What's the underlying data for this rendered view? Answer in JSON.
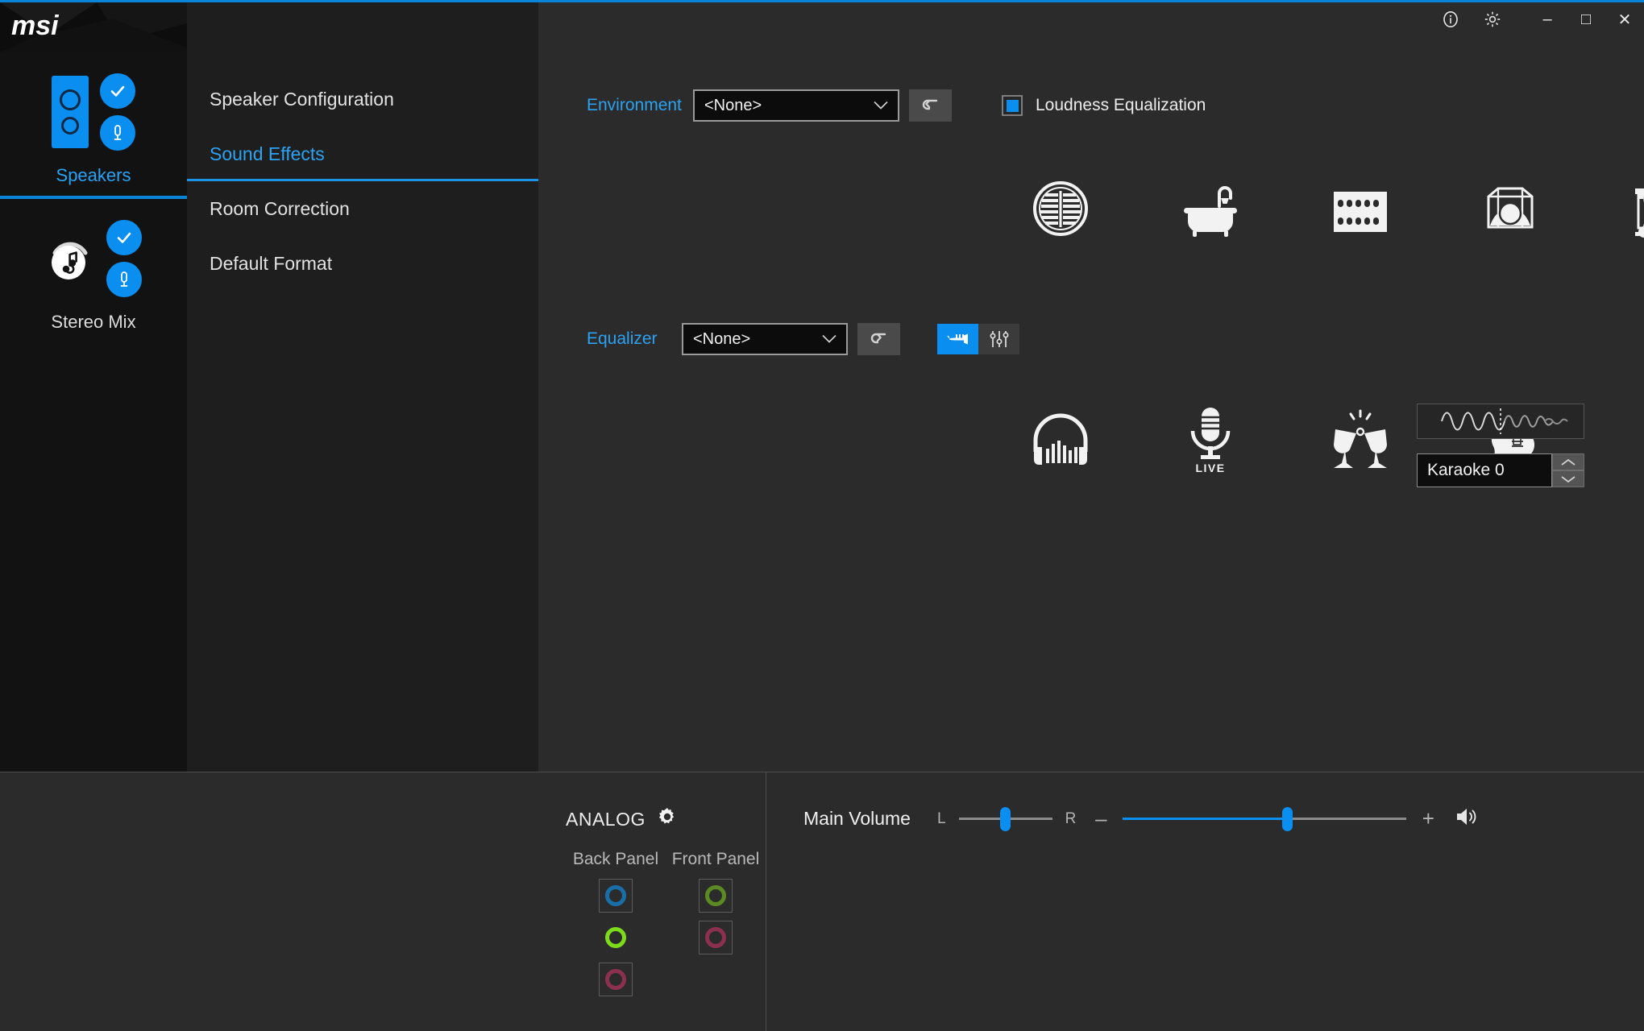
{
  "window": {
    "accent_color": "#0a8ef0",
    "titlebar": {
      "info_icon": "info-icon",
      "settings_icon": "gear-icon",
      "minimize": "–",
      "maximize": "□",
      "close": "✕"
    }
  },
  "brand": {
    "logo_text": "msi"
  },
  "sidebar": {
    "devices": [
      {
        "label": "Speakers",
        "icon": "speaker-icon",
        "active": true,
        "badges": [
          "check-icon",
          "microphone-icon"
        ]
      },
      {
        "label": "Stereo Mix",
        "icon": "music-note-icon",
        "active": false,
        "badges": [
          "check-icon",
          "microphone-icon"
        ]
      }
    ]
  },
  "nav": {
    "items": [
      {
        "label": "Speaker Configuration",
        "selected": false
      },
      {
        "label": "Sound Effects",
        "selected": true
      },
      {
        "label": "Room Correction",
        "selected": false
      },
      {
        "label": "Default Format",
        "selected": false
      }
    ]
  },
  "main": {
    "environment": {
      "label": "Environment",
      "value": "<None>",
      "placeholder": "<None>",
      "reset_icon": "reset-arrow-icon",
      "loudness": {
        "label": "Loudness Equalization",
        "checked": true
      }
    },
    "environment_presets": [
      {
        "name": "padded-cell-icon"
      },
      {
        "name": "bathroom-icon"
      },
      {
        "name": "stone-corridor-icon"
      },
      {
        "name": "arena-icon"
      },
      {
        "name": "auditorium-icon"
      }
    ],
    "equalizer": {
      "label": "Equalizer",
      "value": "<None>",
      "placeholder": "<None>",
      "reset_icon": "reset-arrow-icon",
      "mode_buttons": [
        {
          "name": "trumpet-icon",
          "active": true
        },
        {
          "name": "sliders-icon",
          "active": false
        }
      ]
    },
    "equalizer_presets": [
      {
        "name": "headphones-icon"
      },
      {
        "name": "live-microphone-icon",
        "caption": "LIVE"
      },
      {
        "name": "party-glasses-icon"
      },
      {
        "name": "electric-guitar-icon"
      }
    ],
    "karaoke": {
      "waveform_icon": "waveform-icon",
      "value": "Karaoke 0",
      "up_icon": "chevron-up-icon",
      "down_icon": "chevron-down-icon"
    }
  },
  "bottom": {
    "analog": {
      "title": "ANALOG",
      "settings_icon": "gear-icon",
      "columns": [
        {
          "header": "Back Panel",
          "jacks": [
            {
              "color": "#1a6ea8",
              "boxed": true,
              "name": "jack-blue-line-in"
            },
            {
              "color": "#7ddb1c",
              "boxed": false,
              "name": "jack-green-line-out"
            },
            {
              "color": "#8d3050",
              "boxed": true,
              "name": "jack-pink-mic-in"
            }
          ]
        },
        {
          "header": "Front Panel",
          "jacks": [
            {
              "color": "#5c8a22",
              "boxed": true,
              "name": "jack-green-headphone"
            },
            {
              "color": "#8d3050",
              "boxed": true,
              "name": "jack-pink-mic-in"
            }
          ]
        }
      ]
    },
    "volume": {
      "title": "Main Volume",
      "balance": {
        "left_label": "L",
        "right_label": "R",
        "value": 50
      },
      "level": {
        "minus": "–",
        "plus": "+",
        "value": 58,
        "speaker_icon": "volume-speaker-icon"
      }
    }
  }
}
